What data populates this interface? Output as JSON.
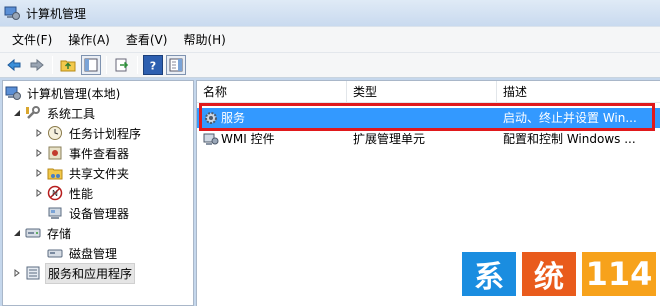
{
  "window": {
    "title": "计算机管理"
  },
  "menu": {
    "items": [
      "文件(F)",
      "操作(A)",
      "查看(V)",
      "帮助(H)"
    ]
  },
  "toolbar": {
    "buttons": [
      "back-icon",
      "forward-icon",
      "up-folder-icon",
      "show-hide-tree-icon",
      "export-icon",
      "help-icon",
      "action-pane-icon"
    ]
  },
  "tree": {
    "root": "计算机管理(本地)",
    "items": [
      {
        "label": "系统工具",
        "icon": "wrench-icon",
        "expanded": true
      },
      {
        "label": "任务计划程序",
        "icon": "clock-icon"
      },
      {
        "label": "事件查看器",
        "icon": "event-viewer-icon"
      },
      {
        "label": "共享文件夹",
        "icon": "shared-folder-icon"
      },
      {
        "label": "性能",
        "icon": "no-entry-icon"
      },
      {
        "label": "设备管理器",
        "icon": "device-manager-icon"
      },
      {
        "label": "存储",
        "icon": "storage-icon",
        "expanded": true
      },
      {
        "label": "磁盘管理",
        "icon": "disk-icon"
      },
      {
        "label": "服务和应用程序",
        "icon": "services-apps-icon",
        "selected": true
      }
    ]
  },
  "list": {
    "columns": [
      "名称",
      "类型",
      "描述"
    ],
    "rows": [
      {
        "name": "服务",
        "type": "",
        "description": "启动、终止并设置 Win...",
        "selected": true
      },
      {
        "name": "WMI 控件",
        "type": "扩展管理单元",
        "description": "配置和控制 Windows ..."
      }
    ]
  },
  "watermark": {
    "parts": [
      "系",
      "统",
      "114"
    ],
    "colors": [
      "#1a8de0",
      "#e95b1c",
      "#f7a21b"
    ]
  },
  "colors": {
    "selection": "#3399ff",
    "highlight_border": "#e0191c"
  }
}
